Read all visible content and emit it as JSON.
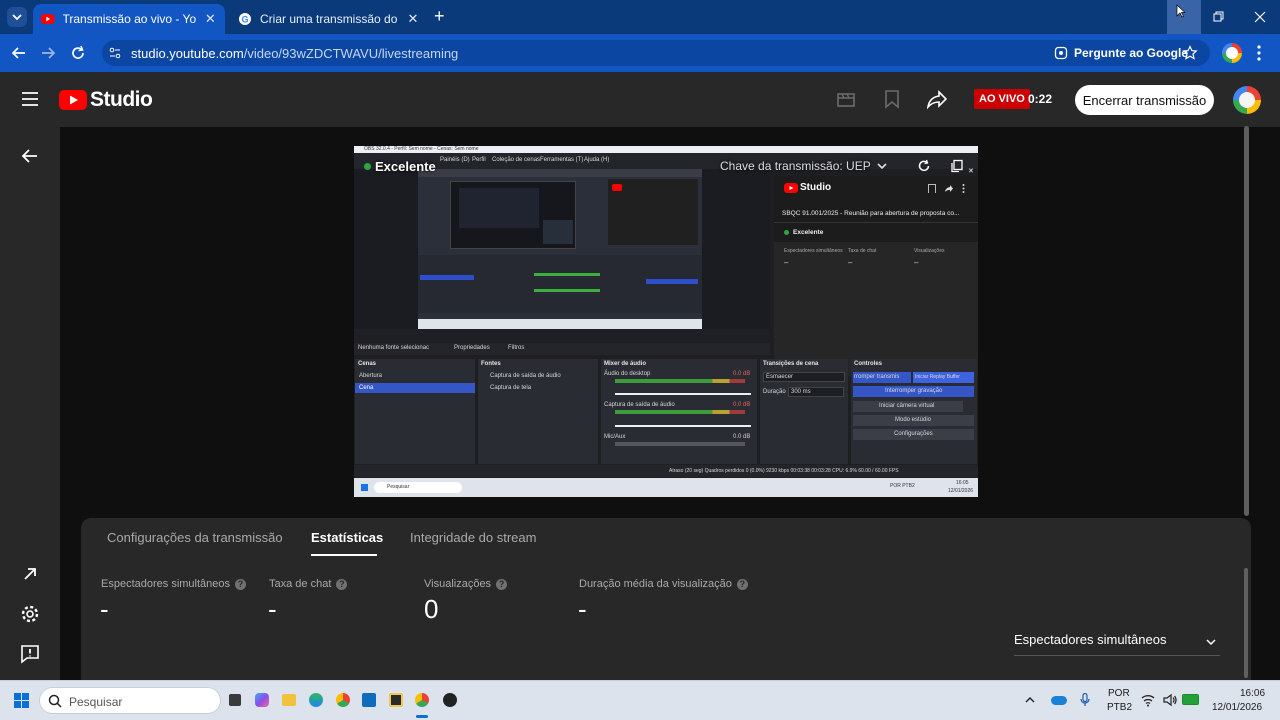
{
  "browser": {
    "tabs": [
      {
        "title": "Transmissão ao vivo - YouTube",
        "active": true
      },
      {
        "title": "Criar uma transmissão do YouTube",
        "active": false
      }
    ],
    "url_host": "studio.youtube.com",
    "url_path": "/video/93wZDCTWAVU/livestreaming",
    "ask_google": "Pergunte ao Google"
  },
  "studio": {
    "logo_text": "Studio",
    "live_label": "AO VIVO",
    "live_time": "0:22",
    "end_button": "Encerrar transmissão"
  },
  "preview": {
    "health": "Excelente",
    "stream_key": "Chave da transmissão: UEP",
    "obs": {
      "title_bar": "OBS 32.0.4 - Perfil: Sem nome - Cenas: Sem nome",
      "menu": [
        "Painéis (D)",
        "Perfil",
        "Coleção de cenas",
        "Ferramentas (T)",
        "Ajuda (H)"
      ],
      "no_source": "Nenhuma fonte selecionac",
      "properties": "Propriedades",
      "filters": "Filtros",
      "scenes_header": "Cenas",
      "scenes": [
        "Abertura",
        "Cena"
      ],
      "sources_header": "Fontes",
      "sources": [
        "Captura de saída de áudio",
        "Captura de tela"
      ],
      "mixer_header": "Mixer de áudio",
      "mixer": [
        {
          "name": "Áudio do desktop",
          "db": "0.0 dB"
        },
        {
          "name": "Captura de saída de áudio",
          "db": "0.0 dB"
        },
        {
          "name": "Mic/Aux",
          "db": "0.0 dB"
        }
      ],
      "transitions_header": "Transições de cena",
      "transition": "Esmaecer",
      "duration_label": "Duração",
      "duration": "300 ms",
      "controls_header": "Controles",
      "controls": [
        "rromper transmis",
        "Iniciar Replay Buffer",
        "Interromper gravação",
        "Iniciar câmera virtual",
        "Modo estúdio",
        "Configurações"
      ],
      "status": "Atraso (20 seg)   Quadros perdidos 0 (0.0%)      9230 kbps      00:03:38      00:03:28   CPU: 6.9%   60.00 / 60.00 FPS",
      "win_search": "Pesquisar",
      "win_lang": "POR PTB2",
      "win_time": "16:05",
      "win_date": "12/01/2026"
    },
    "inner_studio": {
      "logo": "Studio",
      "title": "SBQC 91.001/2025 - Reunião para abertura de proposta co...",
      "health": "Excelente",
      "stats": [
        "Espectadores simultâneos",
        "Taxa de chat",
        "Visualizações"
      ],
      "values": [
        "–",
        "–",
        "–"
      ]
    }
  },
  "panel": {
    "tabs": [
      "Configurações da transmissão",
      "Estatísticas",
      "Integridade do stream"
    ],
    "active_tab": "Estatísticas",
    "stats": [
      {
        "label": "Espectadores simultâneos",
        "value": "-"
      },
      {
        "label": "Taxa de chat",
        "value": "-"
      },
      {
        "label": "Visualizações",
        "value": "0"
      },
      {
        "label": "Duração média da visualização",
        "value": "-"
      }
    ],
    "dropdown": "Espectadores simultâneos"
  },
  "taskbar": {
    "search": "Pesquisar",
    "lang1": "POR",
    "lang2": "PTB2",
    "time": "16:06",
    "date": "12/01/2026"
  },
  "colors": {
    "chrome_tabstrip": "#0b3a7a",
    "chrome_toolbar": "#1256c4",
    "youtube_red": "#ff0000",
    "live_red": "#cc0000",
    "studio_bg": "#0f0f0f",
    "panel_bg": "#282828"
  }
}
